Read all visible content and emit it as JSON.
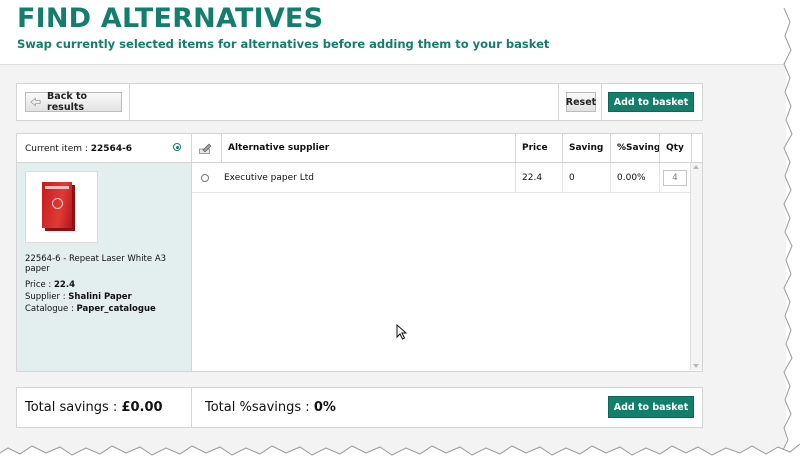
{
  "header": {
    "title": "FIND ALTERNATIVES",
    "subtitle": "Swap currently selected items for alternatives before adding them to your basket"
  },
  "toolbar": {
    "back_label": "Back to results",
    "reset_label": "Reset",
    "add_label": "Add to basket"
  },
  "current_item": {
    "label": "Current item :",
    "code": "22564-6",
    "name": "22564-6 - Repeat Laser White A3 paper",
    "price_label": "Price :",
    "price": "22.4",
    "supplier_label": "Supplier :",
    "supplier": "Shalini Paper",
    "catalogue_label": "Catalogue :",
    "catalogue": "Paper_catalogue"
  },
  "grid": {
    "columns": [
      "Alternative supplier",
      "Price",
      "Saving",
      "%Saving",
      "Qty"
    ],
    "rows": [
      {
        "supplier": "Executive paper Ltd",
        "price": "22.4",
        "saving": "0",
        "pct_saving": "0.00%",
        "qty": "4"
      }
    ]
  },
  "footer": {
    "total_savings_label": "Total savings :",
    "total_savings": "£0.00",
    "total_pct_label": "Total %savings :",
    "total_pct": "0%",
    "add_label": "Add to basket"
  },
  "colors": {
    "accent": "#137e6b",
    "left_panel": "#e3eeee"
  },
  "icons": [
    "back-arrow-icon",
    "radio-selected-icon",
    "edit-pencil-icon",
    "radio-unselected-icon",
    "mouse-pointer-icon"
  ]
}
